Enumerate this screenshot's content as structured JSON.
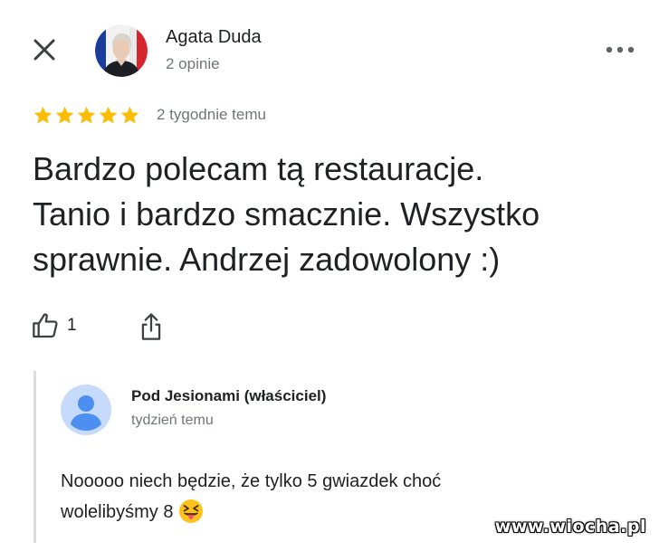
{
  "header": {
    "reviewer_name": "Agata Duda",
    "reviewer_reviews": "2 opinie",
    "close_icon": "close-icon",
    "more_icon": "more-horizontal-icon"
  },
  "review": {
    "rating": 5,
    "rating_max": 5,
    "star_color": "#fbbc04",
    "time": "2 tygodnie temu",
    "text_lines": [
      "Bardzo polecam tą restauracje.",
      "Tanio i bardzo smacznie. Wszystko",
      "sprawnie. Andrzej zadowolony :)"
    ],
    "likes": "1",
    "like_icon": "thumb-up-icon",
    "share_icon": "share-icon"
  },
  "owner_reply": {
    "name": "Pod Jesionami (właściciel)",
    "time": "tydzień temu",
    "avatar_color": "#c6dafc",
    "avatar_figure_color": "#4d8ff0",
    "text_lines": [
      "Nooooo niech będzie, że tylko 5 gwiazdek choć",
      "wolelibyśmy 8"
    ],
    "emoji_icon": "squinting-face-with-tongue-icon"
  },
  "watermark": "www.wiocha.pl"
}
